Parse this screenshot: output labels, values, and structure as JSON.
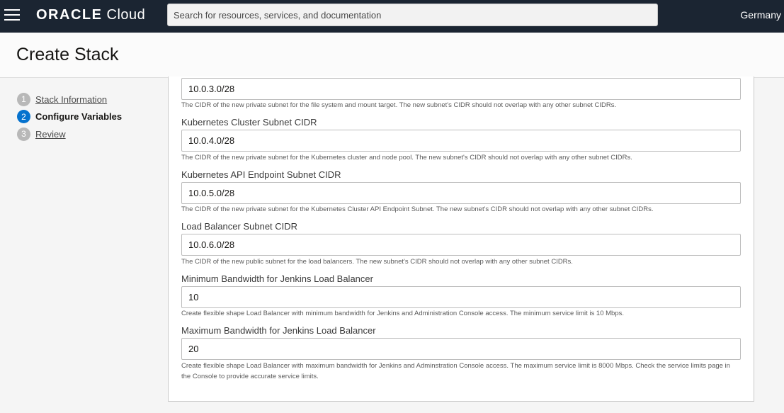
{
  "topbar": {
    "logo_brand": "ORACLE",
    "logo_product": "Cloud",
    "search_placeholder": "Search for resources, services, and documentation",
    "region": "Germany"
  },
  "page": {
    "title": "Create Stack"
  },
  "steps": [
    {
      "number": "1",
      "label": "Stack Information"
    },
    {
      "number": "2",
      "label": "Configure Variables"
    },
    {
      "number": "3",
      "label": "Review"
    }
  ],
  "fields": {
    "fs_subnet": {
      "value": "10.0.3.0/28",
      "help": "The CIDR of the new private subnet for the file system and mount target. The new subnet's CIDR should not overlap with any other subnet CIDRs."
    },
    "k8s_cluster_subnet": {
      "label": "Kubernetes Cluster Subnet CIDR",
      "value": "10.0.4.0/28",
      "help": "The CIDR of the new private subnet for the Kubernetes cluster and node pool. The new subnet's CIDR should not overlap with any other subnet CIDRs."
    },
    "k8s_api_subnet": {
      "label": "Kubernetes API Endpoint Subnet CIDR",
      "value": "10.0.5.0/28",
      "help": "The CIDR of the new private subnet for the Kubernetes Cluster API Endpoint Subnet. The new subnet's CIDR should not overlap with any other subnet CIDRs."
    },
    "lb_subnet": {
      "label": "Load Balancer Subnet CIDR",
      "value": "10.0.6.0/28",
      "help": "The CIDR of the new public subnet for the load balancers. The new subnet's CIDR should not overlap with any other subnet CIDRs."
    },
    "min_bw": {
      "label": "Minimum Bandwidth for Jenkins Load Balancer",
      "value": "10",
      "help": "Create flexible shape Load Balancer with minimum bandwidth for Jenkins and Administration Console access. The minimum service limit is 10 Mbps."
    },
    "max_bw": {
      "label": "Maximum Bandwidth for Jenkins Load Balancer",
      "value": "20",
      "help": "Create flexible shape Load Balancer with maximum bandwidth for Jenkins and Adminstration Console access. The maximum service limit is 8000 Mbps. Check the service limits page in the Console to provide accurate service limits."
    }
  }
}
